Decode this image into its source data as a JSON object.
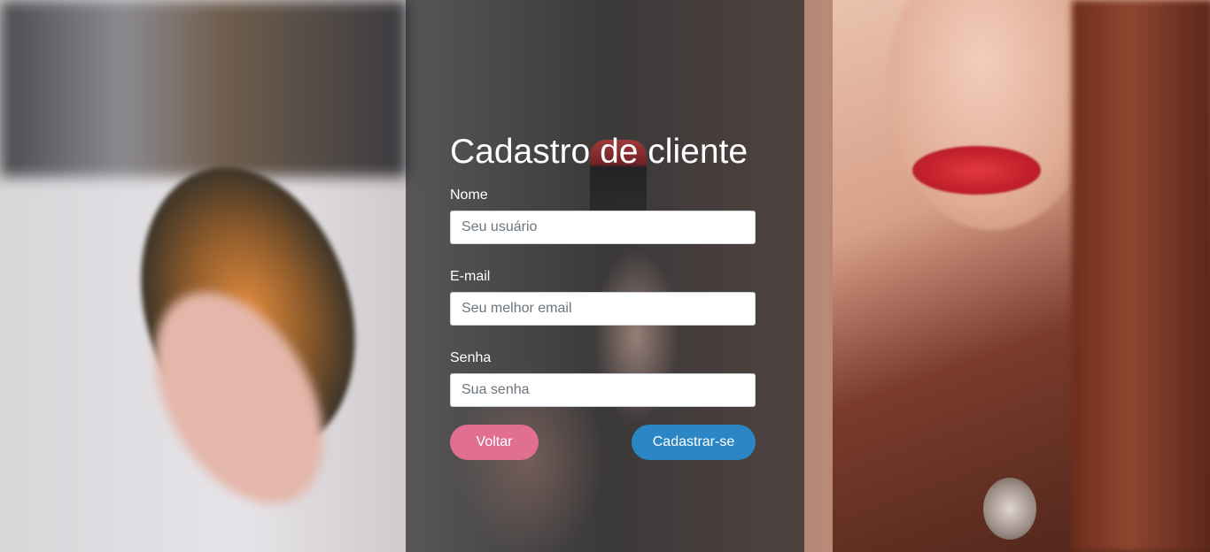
{
  "form": {
    "title": "Cadastro de cliente",
    "fields": [
      {
        "label": "Nome",
        "placeholder": "Seu usuário",
        "value": ""
      },
      {
        "label": "E-mail",
        "placeholder": "Seu melhor email",
        "value": ""
      },
      {
        "label": "Senha",
        "placeholder": "Sua senha",
        "value": ""
      }
    ],
    "buttons": {
      "back_label": "Voltar",
      "submit_label": "Cadastrar-se"
    }
  },
  "colors": {
    "back_button": "#e06f92",
    "submit_button": "#2a86c4",
    "panel_overlay": "rgba(40,40,42,0.72)"
  }
}
